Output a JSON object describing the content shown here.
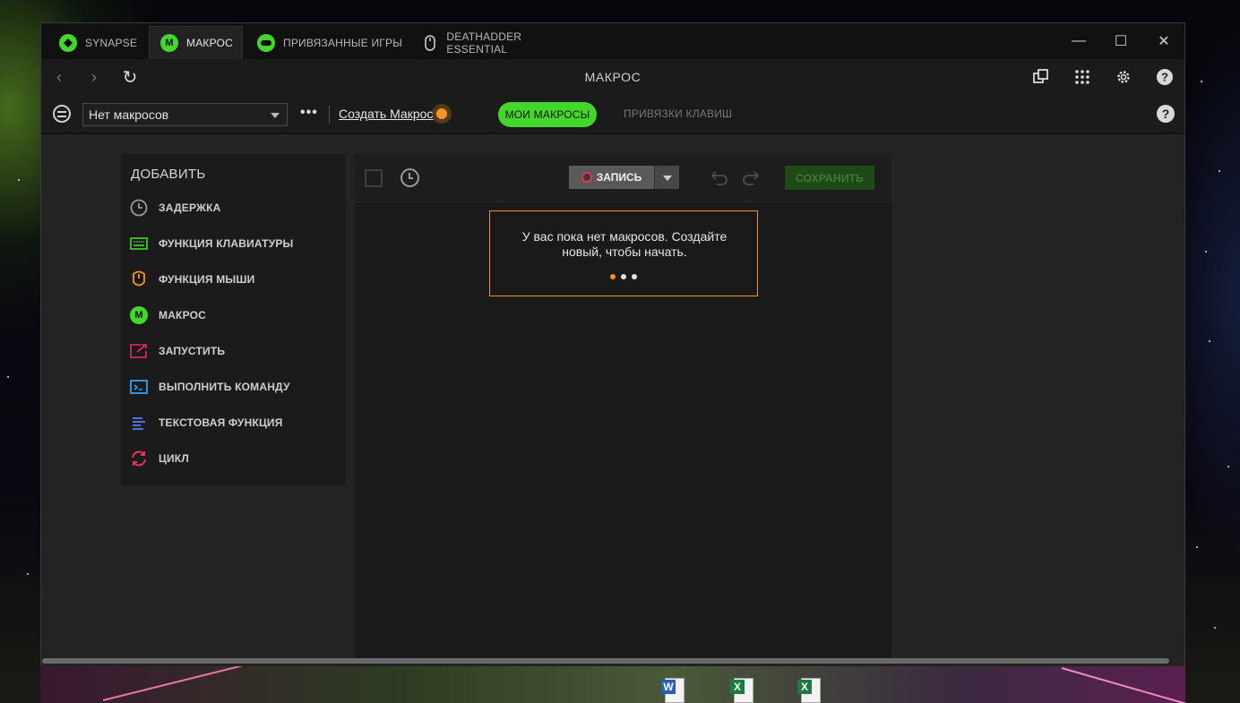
{
  "window": {
    "tabs": [
      {
        "label": "SYNAPSE",
        "icon": "razer-snake-icon"
      },
      {
        "label": "МАКРОС",
        "icon": "macro-m-icon",
        "icon_text": "M",
        "active": true
      },
      {
        "label": "ПРИВЯЗАННЫЕ ИГРЫ",
        "icon": "gamepad-icon"
      },
      {
        "label": "DEATHADDER ESSENTIAL",
        "icon": "mouse-icon"
      }
    ],
    "controls": {
      "minimize": "—",
      "maximize": "☐",
      "close": "✕"
    }
  },
  "header": {
    "title": "МАКРОС",
    "nav": {
      "back": "‹",
      "forward": "›",
      "refresh": "↻"
    },
    "icons": [
      "copy-device-icon",
      "apps-grid-icon",
      "gear-icon",
      "support-icon"
    ]
  },
  "toolbar": {
    "profile_select": "Нет макросов",
    "more": "•••",
    "create_link": "Создать Макрос",
    "my_macros_pill": "МОИ МАКРОСЫ",
    "key_bindings_tab": "ПРИВЯЗКИ КЛАВИШ",
    "help": "?"
  },
  "add_panel": {
    "title": "ДОБАВИТЬ",
    "items": [
      {
        "label": "ЗАДЕРЖКА",
        "icon": "clock-icon",
        "color": "#9a9a9a"
      },
      {
        "label": "ФУНКЦИЯ КЛАВИАТУРЫ",
        "icon": "keyboard-icon",
        "color": "#44d62c"
      },
      {
        "label": "ФУНКЦИЯ МЫШИ",
        "icon": "mouse-icon",
        "color": "#f7941d"
      },
      {
        "label": "МАКРОС",
        "icon": "macro-m-icon",
        "icon_text": "M",
        "color": "#44d62c"
      },
      {
        "label": "ЗАПУСТИТЬ",
        "icon": "launch-icon",
        "color": "#d6246e"
      },
      {
        "label": "ВЫПОЛНИТЬ КОМАНДУ",
        "icon": "terminal-icon",
        "color": "#2ea3f2"
      },
      {
        "label": "ТЕКСТОВАЯ ФУНКЦИЯ",
        "icon": "text-lines-icon",
        "color": "#5b7cf7"
      },
      {
        "label": "ЦИКЛ",
        "icon": "loop-icon",
        "color": "#e8315a"
      }
    ]
  },
  "editor": {
    "record_label": "ЗАПИСЬ",
    "save_label": "СОХРАНИТЬ",
    "tooltip": "У вас пока нет макросов. Создайте новый, чтобы начать.",
    "tooltip_step": 1,
    "tooltip_steps": 3
  },
  "colors": {
    "accent": "#44d62c",
    "highlight": "#f7941d",
    "record": "#e8315a"
  }
}
